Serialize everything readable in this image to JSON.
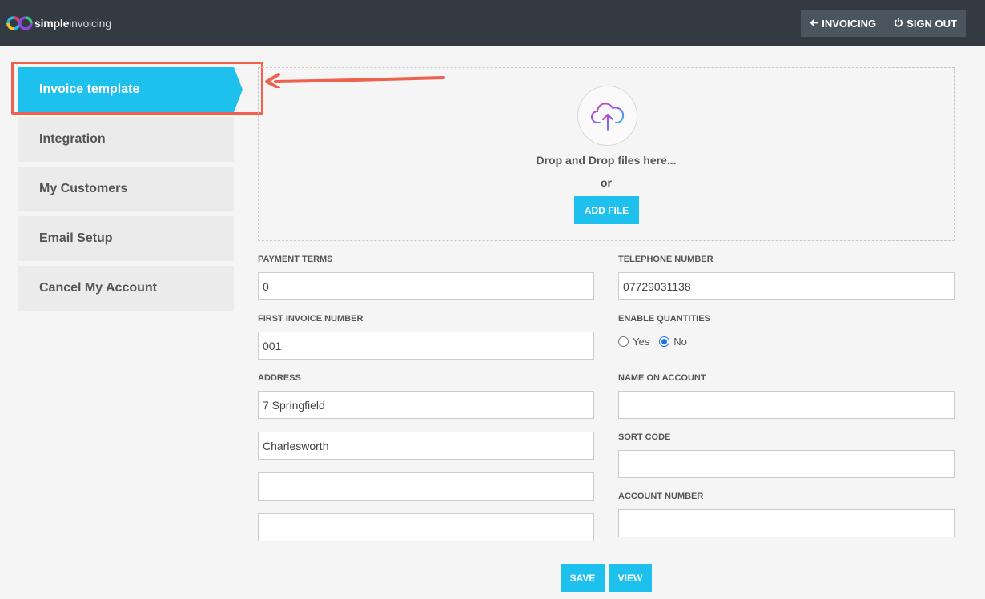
{
  "header": {
    "logo_bold": "simple",
    "logo_light": "invoicing",
    "nav": [
      {
        "label": "INVOICING",
        "icon": "arrow-left-icon"
      },
      {
        "label": "SIGN OUT",
        "icon": "power-icon"
      }
    ]
  },
  "sidebar": {
    "items": [
      {
        "label": "Invoice template",
        "active": true
      },
      {
        "label": "Integration"
      },
      {
        "label": "My Customers"
      },
      {
        "label": "Email Setup"
      },
      {
        "label": "Cancel My Account"
      }
    ]
  },
  "upload": {
    "drop_text": "Drop and Drop files here...",
    "or_text": "or",
    "add_file_label": "ADD FILE",
    "icon": "cloud-upload-icon"
  },
  "form": {
    "payment_terms": {
      "label": "PAYMENT TERMS",
      "value": "0"
    },
    "first_invoice_number": {
      "label": "FIRST INVOICE NUMBER",
      "value": "001"
    },
    "address": {
      "label": "ADDRESS",
      "line1": "7 Springfield",
      "line2": "Charlesworth",
      "line3": "",
      "line4": ""
    },
    "telephone_number": {
      "label": "TELEPHONE NUMBER",
      "value": "07729031138"
    },
    "enable_quantities": {
      "label": "ENABLE QUANTITIES",
      "yes_label": "Yes",
      "no_label": "No",
      "selected": "No"
    },
    "name_on_account": {
      "label": "NAME ON ACCOUNT",
      "value": ""
    },
    "sort_code": {
      "label": "SORT CODE",
      "value": ""
    },
    "account_number": {
      "label": "ACCOUNT NUMBER",
      "value": ""
    }
  },
  "actions": {
    "save_label": "SAVE",
    "view_label": "VIEW"
  },
  "colors": {
    "accent": "#1ec0ee",
    "header_bg": "#343a41",
    "annotation": "#f0604f"
  }
}
